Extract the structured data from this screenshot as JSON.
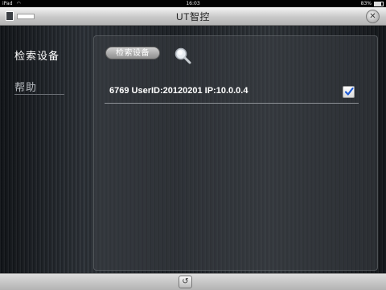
{
  "status_bar": {
    "device": "iPad",
    "time": "16:03",
    "battery": "83%",
    "battery_level": 0.83
  },
  "header": {
    "title": "UT智控"
  },
  "sidebar": {
    "items": [
      {
        "label": "检索设备",
        "active": true
      },
      {
        "label": "帮助",
        "active": false
      }
    ]
  },
  "main": {
    "scan_button_label": "检索设备",
    "devices": [
      {
        "text": "6769  UserID:20120201  IP:10.0.0.4",
        "checked": true
      }
    ]
  },
  "icons": {
    "search": "search-icon",
    "checkbox": "checkmark-icon",
    "back": "back-arrow-icon",
    "close": "close-icon"
  },
  "colors": {
    "checkmark": "#1e5bd6"
  }
}
